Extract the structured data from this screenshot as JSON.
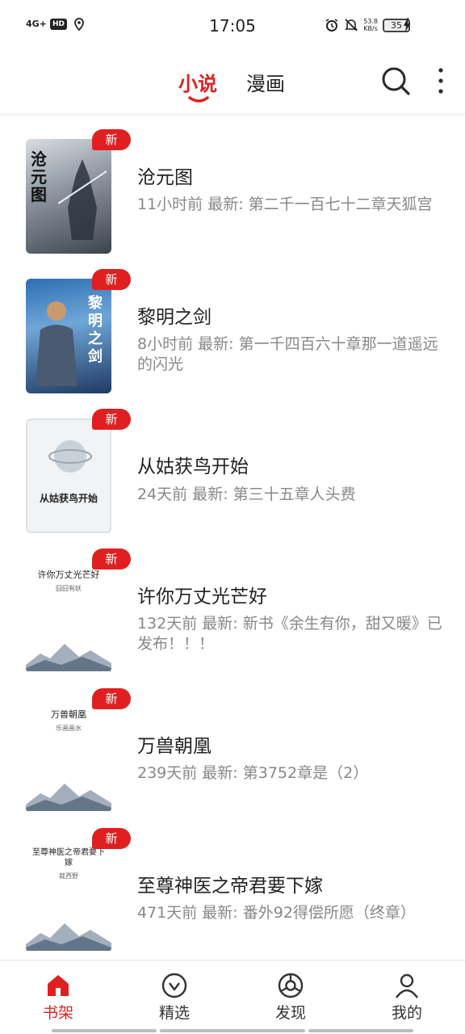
{
  "status": {
    "network": "4G+",
    "hd": "HD",
    "time": "17:05",
    "speed_value": "53.8",
    "speed_unit": "KB/s",
    "battery": "35"
  },
  "tabs": [
    {
      "label": "小说",
      "active": true
    },
    {
      "label": "漫画",
      "active": false
    }
  ],
  "badge_label": "新",
  "books": [
    {
      "title": "沧元图",
      "meta": "11小时前 最新: 第二千一百七十二章天狐宫",
      "cover_text": "沧元图"
    },
    {
      "title": "黎明之剑",
      "meta": "8小时前 最新: 第一千四百六十章那一道遥远的闪光",
      "cover_text": "黎明之剑"
    },
    {
      "title": "从姑获鸟开始",
      "meta": "24天前 最新: 第三十五章人头费",
      "cover_text": "从姑获鸟开始"
    },
    {
      "title": "许你万丈光芒好",
      "meta": "132天前 最新: 新书《余生有你，甜又暖》已发布！！！",
      "cover_text": "许你万丈光芒好",
      "cover_author": "囧囧有妖"
    },
    {
      "title": "万兽朝凰",
      "meta": "239天前 最新: 第3752章是（2）",
      "cover_text": "万兽朝凰",
      "cover_author": "乐画画水"
    },
    {
      "title": "至尊神医之帝君要下嫁",
      "meta": "471天前 最新: 番外92得偿所愿（终章）",
      "cover_text": "至尊神医之帝君要下嫁",
      "cover_author": "裁西野"
    }
  ],
  "nav": [
    {
      "label": "书架",
      "icon": "home-icon",
      "active": true
    },
    {
      "label": "精选",
      "icon": "featured-icon",
      "active": false
    },
    {
      "label": "发现",
      "icon": "discover-icon",
      "active": false
    },
    {
      "label": "我的",
      "icon": "profile-icon",
      "active": false
    }
  ],
  "colors": {
    "accent": "#e02020"
  }
}
